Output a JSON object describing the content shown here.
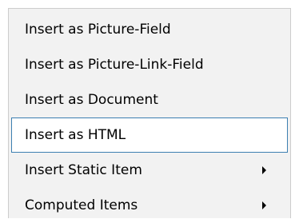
{
  "menu": {
    "items": [
      {
        "label": "Insert as Picture-Field"
      },
      {
        "label": "Insert as Picture-Link-Field"
      },
      {
        "label": "Insert as Document"
      },
      {
        "label": "Insert as HTML"
      },
      {
        "label": "Insert Static Item"
      },
      {
        "label": "Computed Items"
      }
    ],
    "highlighted_item": "Insert as HTML",
    "submenu_indicator_icon": "chevron-right-icon",
    "colors": {
      "background": "#f2f2f2",
      "highlight_background": "#ffffff",
      "highlight_border": "#3c7fb1",
      "text": "#000000"
    }
  }
}
